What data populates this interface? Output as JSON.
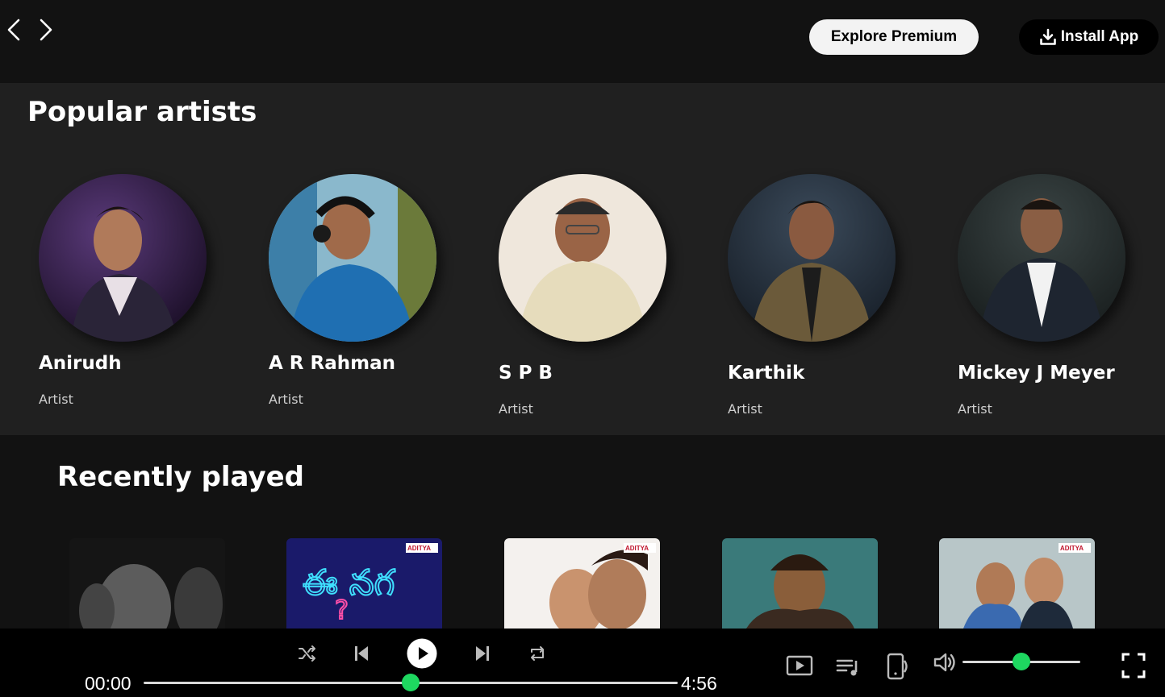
{
  "topbar": {
    "back_icon": "chevron-left-icon",
    "forward_icon": "chevron-right-icon",
    "explore_premium_label": "Explore Premium",
    "install_app_label": "Install App",
    "install_icon": "download-icon"
  },
  "popular_artists": {
    "title": "Popular artists",
    "artists": [
      {
        "name": "Anirudh",
        "role": "Artist"
      },
      {
        "name": "A R Rahman",
        "role": "Artist"
      },
      {
        "name": "S P B",
        "role": "Artist"
      },
      {
        "name": "Karthik",
        "role": "Artist"
      },
      {
        "name": "Mickey J Meyer",
        "role": "Artist"
      }
    ]
  },
  "recently_played": {
    "title": "Recently played",
    "album_badge": "ADITYA"
  },
  "player": {
    "current_time": "00:00",
    "total_time": "4:56",
    "progress": 0.5,
    "volume": 0.5,
    "accent_color": "#1ed760"
  }
}
